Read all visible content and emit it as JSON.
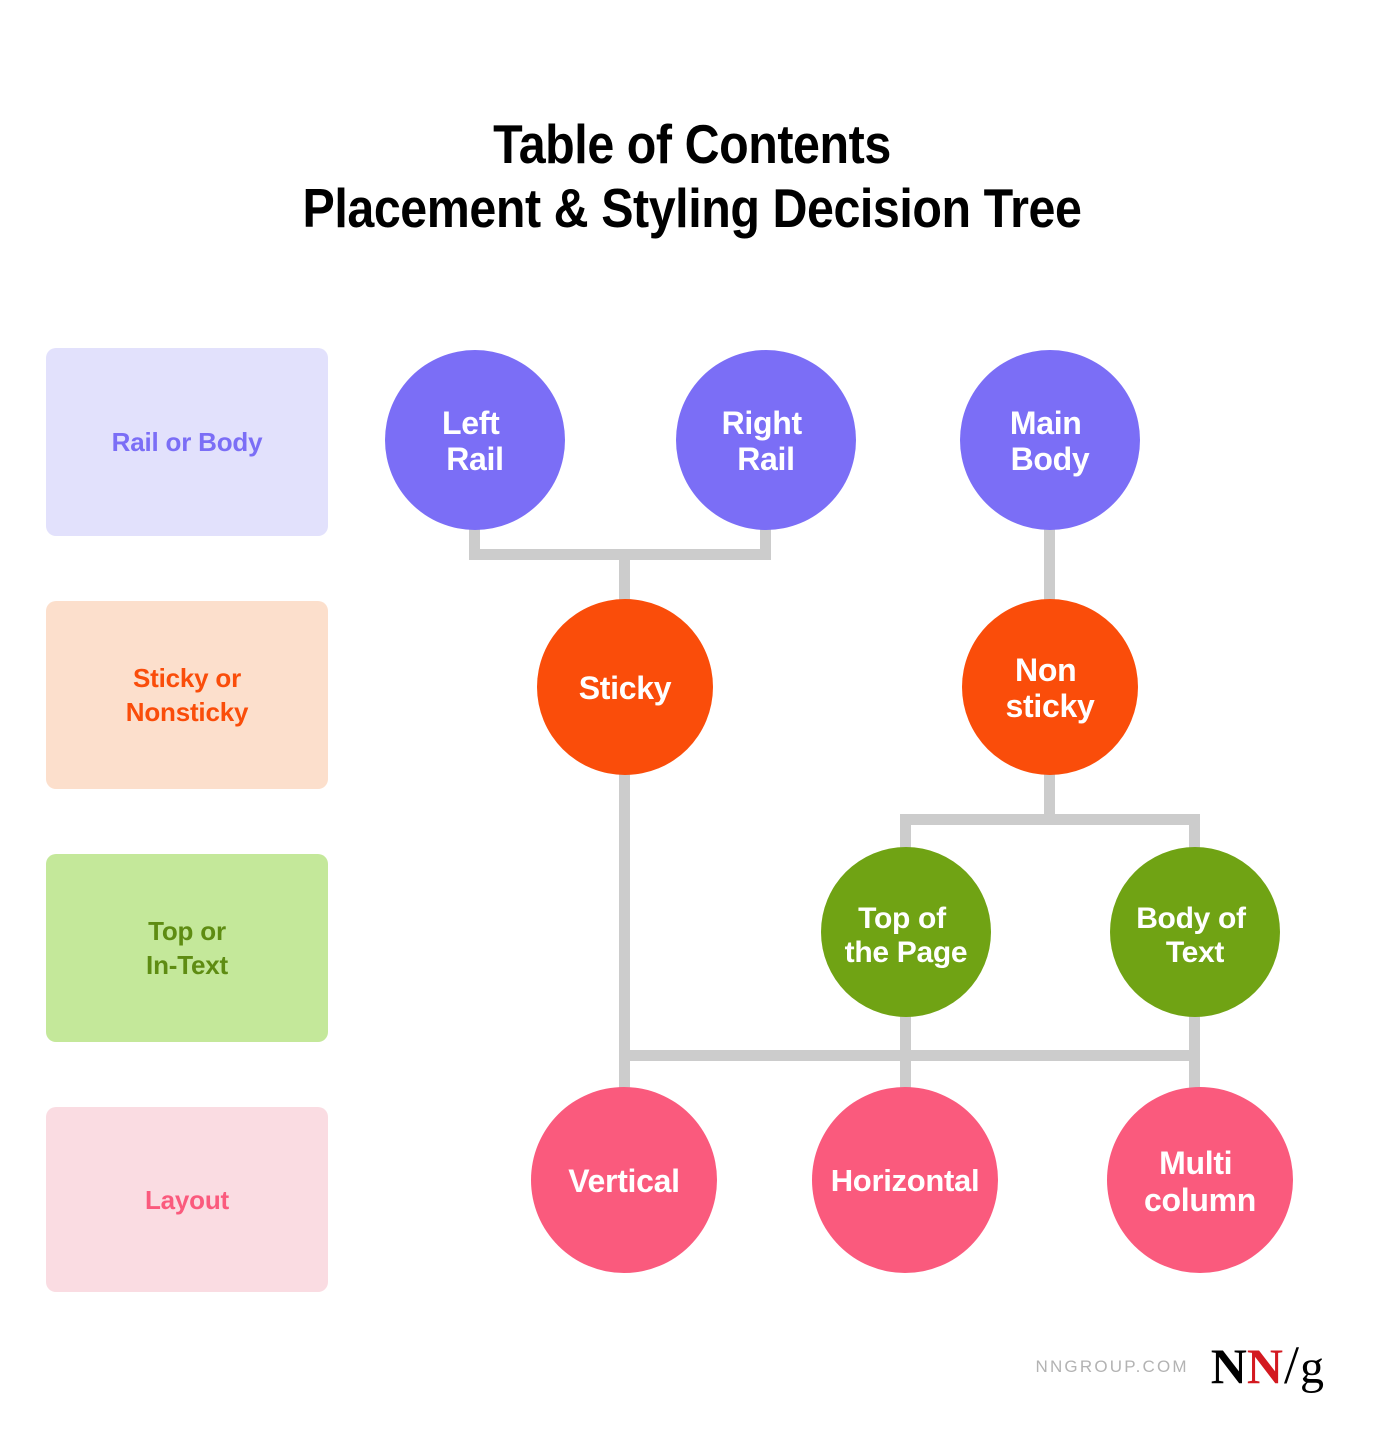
{
  "title": {
    "line1": "Table of Contents",
    "line2": "Placement & Styling Decision Tree"
  },
  "colors": {
    "purple": "#7B6EF6",
    "purple_bg": "#E2E1FC",
    "orange": "#FA4D0A",
    "orange_bg": "#FCDFCC",
    "green": "#70A314",
    "green_bg": "#C4E89A",
    "pink": "#FA5A7D",
    "pink_bg": "#FADCE2",
    "connector": "#CCCCCC",
    "title": "#000000",
    "logo_red": "#D31920",
    "footer_url": "#B3B3B3"
  },
  "legend": {
    "items": [
      {
        "label": "Rail or Body",
        "bg": "#E2E1FC",
        "fg": "#7B6EF6",
        "lines": [
          "Rail or Body"
        ]
      },
      {
        "label": "Sticky or Nonsticky",
        "bg": "#FCDFCC",
        "fg": "#FA4D0A",
        "lines": [
          "Sticky or",
          "Nonsticky"
        ]
      },
      {
        "label": "Top or In-Text",
        "bg": "#C4E89A",
        "fg": "#5E8C12",
        "lines": [
          "Top or",
          "In-Text"
        ]
      },
      {
        "label": "Layout",
        "bg": "#FADCE2",
        "fg": "#FA5A7D",
        "lines": [
          "Layout"
        ]
      }
    ]
  },
  "tree": {
    "rows": [
      {
        "name": "rail-or-body",
        "color": "#7B6EF6",
        "nodes": [
          {
            "id": "left-rail",
            "lines": [
              "Left",
              "Rail"
            ]
          },
          {
            "id": "right-rail",
            "lines": [
              "Right",
              "Rail"
            ]
          },
          {
            "id": "main-body",
            "lines": [
              "Main",
              "Body"
            ]
          }
        ]
      },
      {
        "name": "sticky-or-nonsticky",
        "color": "#FA4D0A",
        "nodes": [
          {
            "id": "sticky",
            "lines": [
              "Sticky"
            ]
          },
          {
            "id": "non-sticky",
            "lines": [
              "Non",
              "sticky"
            ]
          }
        ]
      },
      {
        "name": "top-or-in-text",
        "color": "#70A314",
        "nodes": [
          {
            "id": "top-of-the-page",
            "lines": [
              "Top of",
              "the Page"
            ]
          },
          {
            "id": "body-of-text",
            "lines": [
              "Body of",
              "Text"
            ]
          }
        ]
      },
      {
        "name": "layout",
        "color": "#FA5A7D",
        "nodes": [
          {
            "id": "vertical",
            "lines": [
              "Vertical"
            ]
          },
          {
            "id": "horizontal",
            "lines": [
              "Horizontal"
            ]
          },
          {
            "id": "multi-column",
            "lines": [
              "Multi",
              "column"
            ]
          }
        ]
      }
    ]
  },
  "footer": {
    "url": "NNGROUP.COM",
    "logo": {
      "n1": "N",
      "n2": "N",
      "slash": "/",
      "g": "g"
    }
  }
}
